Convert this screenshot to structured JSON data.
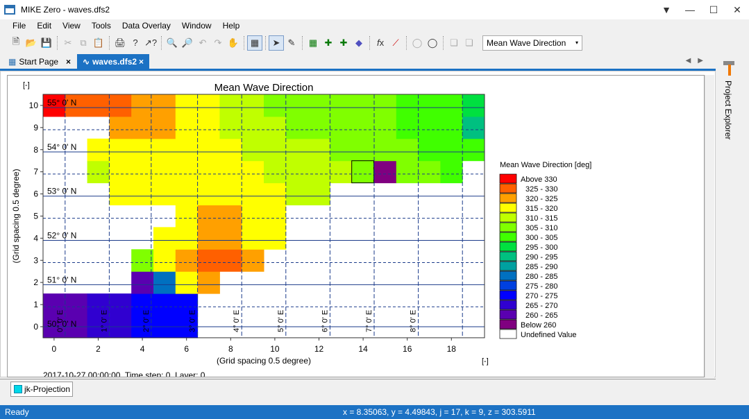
{
  "window": {
    "title": "MIKE Zero - waves.dfs2"
  },
  "menu": [
    "File",
    "Edit",
    "View",
    "Tools",
    "Data Overlay",
    "Window",
    "Help"
  ],
  "toolbar": {
    "item_combo": "Mean Wave Direction"
  },
  "tabs": [
    {
      "label": "Start Page",
      "close": "×"
    },
    {
      "label": "waves.dfs2",
      "close": "×"
    }
  ],
  "plot": {
    "title": "Mean Wave Direction",
    "corner_label": "[-]",
    "xlabel": "(Grid spacing 0.5 degree)",
    "ylabel": "(Grid spacing 0.5 degree)",
    "x_unit": "[-]",
    "xticks": [
      "0",
      "2",
      "4",
      "6",
      "8",
      "10",
      "12",
      "14",
      "16",
      "18"
    ],
    "yticks": [
      "0",
      "1",
      "2",
      "3",
      "4",
      "5",
      "6",
      "7",
      "8",
      "9",
      "10"
    ],
    "lat_labels": [
      "50° 0' N",
      "51° 0' N",
      "52° 0' N",
      "53° 0' N",
      "54° 0' N",
      "55° 0' N"
    ],
    "lon_labels": [
      "0° 0' E",
      "1° 0' E",
      "2° 0' E",
      "3° 0' E",
      "4° 0' E",
      "5° 0' E",
      "6° 0' E",
      "7° 0' E",
      "8° 0' E"
    ],
    "footer": "2017-10-27 00:00:00, Time step: 0, Layer: 0"
  },
  "legend": {
    "title": "Mean Wave Direction [deg]",
    "items": [
      {
        "label": "Above 330",
        "color": "#ff0000"
      },
      {
        "label": "325 - 330",
        "color": "#ff6000"
      },
      {
        "label": "320 - 325",
        "color": "#ffa000"
      },
      {
        "label": "315 - 320",
        "color": "#ffff00"
      },
      {
        "label": "310 - 315",
        "color": "#c0ff00"
      },
      {
        "label": "305 - 310",
        "color": "#80ff00"
      },
      {
        "label": "300 - 305",
        "color": "#40ff00"
      },
      {
        "label": "295 - 300",
        "color": "#00e040"
      },
      {
        "label": "290 - 295",
        "color": "#00c080"
      },
      {
        "label": "285 - 290",
        "color": "#00a0a0"
      },
      {
        "label": "280 - 285",
        "color": "#0070c0"
      },
      {
        "label": "275 - 280",
        "color": "#0040e0"
      },
      {
        "label": "270 - 275",
        "color": "#0000ff"
      },
      {
        "label": "265 - 270",
        "color": "#3000d0"
      },
      {
        "label": "260 - 265",
        "color": "#5a00b0"
      },
      {
        "label": "Below 260",
        "color": "#800080"
      },
      {
        "label": "Undefined Value",
        "color": "#ffffff"
      }
    ]
  },
  "chart_data": {
    "type": "heatmap",
    "title": "Mean Wave Direction",
    "xlabel": "(Grid spacing 0.5 degree)",
    "ylabel": "(Grid spacing 0.5 degree)",
    "xlim": [
      0,
      19
    ],
    "ylim": [
      0,
      10
    ],
    "note_classes": "values are legend class indices: 0=Above 330 ... 15=Below 260, -1=Undefined",
    "grid": [
      [
        14,
        14,
        13,
        13,
        12,
        12,
        12,
        -1,
        -1,
        -1,
        -1,
        -1,
        -1,
        -1,
        -1,
        -1,
        -1,
        -1,
        -1,
        -1
      ],
      [
        14,
        14,
        13,
        13,
        12,
        12,
        12,
        -1,
        -1,
        -1,
        -1,
        -1,
        -1,
        -1,
        -1,
        -1,
        -1,
        -1,
        -1,
        -1
      ],
      [
        -1,
        -1,
        -1,
        -1,
        14,
        10,
        3,
        2,
        -1,
        -1,
        -1,
        -1,
        -1,
        -1,
        -1,
        -1,
        -1,
        -1,
        -1,
        -1
      ],
      [
        -1,
        -1,
        -1,
        -1,
        5,
        3,
        2,
        1,
        1,
        2,
        -1,
        -1,
        -1,
        -1,
        -1,
        -1,
        -1,
        -1,
        -1,
        -1
      ],
      [
        -1,
        -1,
        -1,
        -1,
        -1,
        3,
        3,
        2,
        2,
        3,
        3,
        -1,
        -1,
        -1,
        -1,
        -1,
        -1,
        -1,
        -1,
        -1
      ],
      [
        -1,
        -1,
        -1,
        -1,
        -1,
        -1,
        3,
        2,
        2,
        3,
        3,
        -1,
        -1,
        -1,
        -1,
        -1,
        -1,
        -1,
        -1,
        -1
      ],
      [
        -1,
        -1,
        -1,
        3,
        3,
        3,
        3,
        3,
        3,
        3,
        3,
        4,
        4,
        -1,
        -1,
        -1,
        -1,
        -1,
        -1,
        -1
      ],
      [
        -1,
        -1,
        4,
        3,
        3,
        3,
        3,
        3,
        3,
        3,
        4,
        4,
        4,
        4,
        5,
        15,
        5,
        5,
        6,
        -1
      ],
      [
        -1,
        -1,
        3,
        3,
        3,
        3,
        3,
        3,
        3,
        4,
        4,
        4,
        4,
        5,
        5,
        5,
        5,
        6,
        6,
        6
      ],
      [
        -1,
        -1,
        -1,
        2,
        2,
        2,
        3,
        3,
        4,
        4,
        4,
        5,
        5,
        5,
        5,
        5,
        6,
        6,
        6,
        8
      ],
      [
        0,
        1,
        1,
        1,
        2,
        2,
        3,
        3,
        4,
        4,
        5,
        5,
        5,
        5,
        5,
        5,
        6,
        6,
        6,
        7
      ]
    ]
  },
  "bottom_tab": {
    "label": "jk-Projection"
  },
  "side_panel": {
    "label": "Project Explorer"
  },
  "status": {
    "ready": "Ready",
    "coords": "x = 8.35063, y = 4.49843, j = 17, k = 9, z = 303.5911"
  }
}
